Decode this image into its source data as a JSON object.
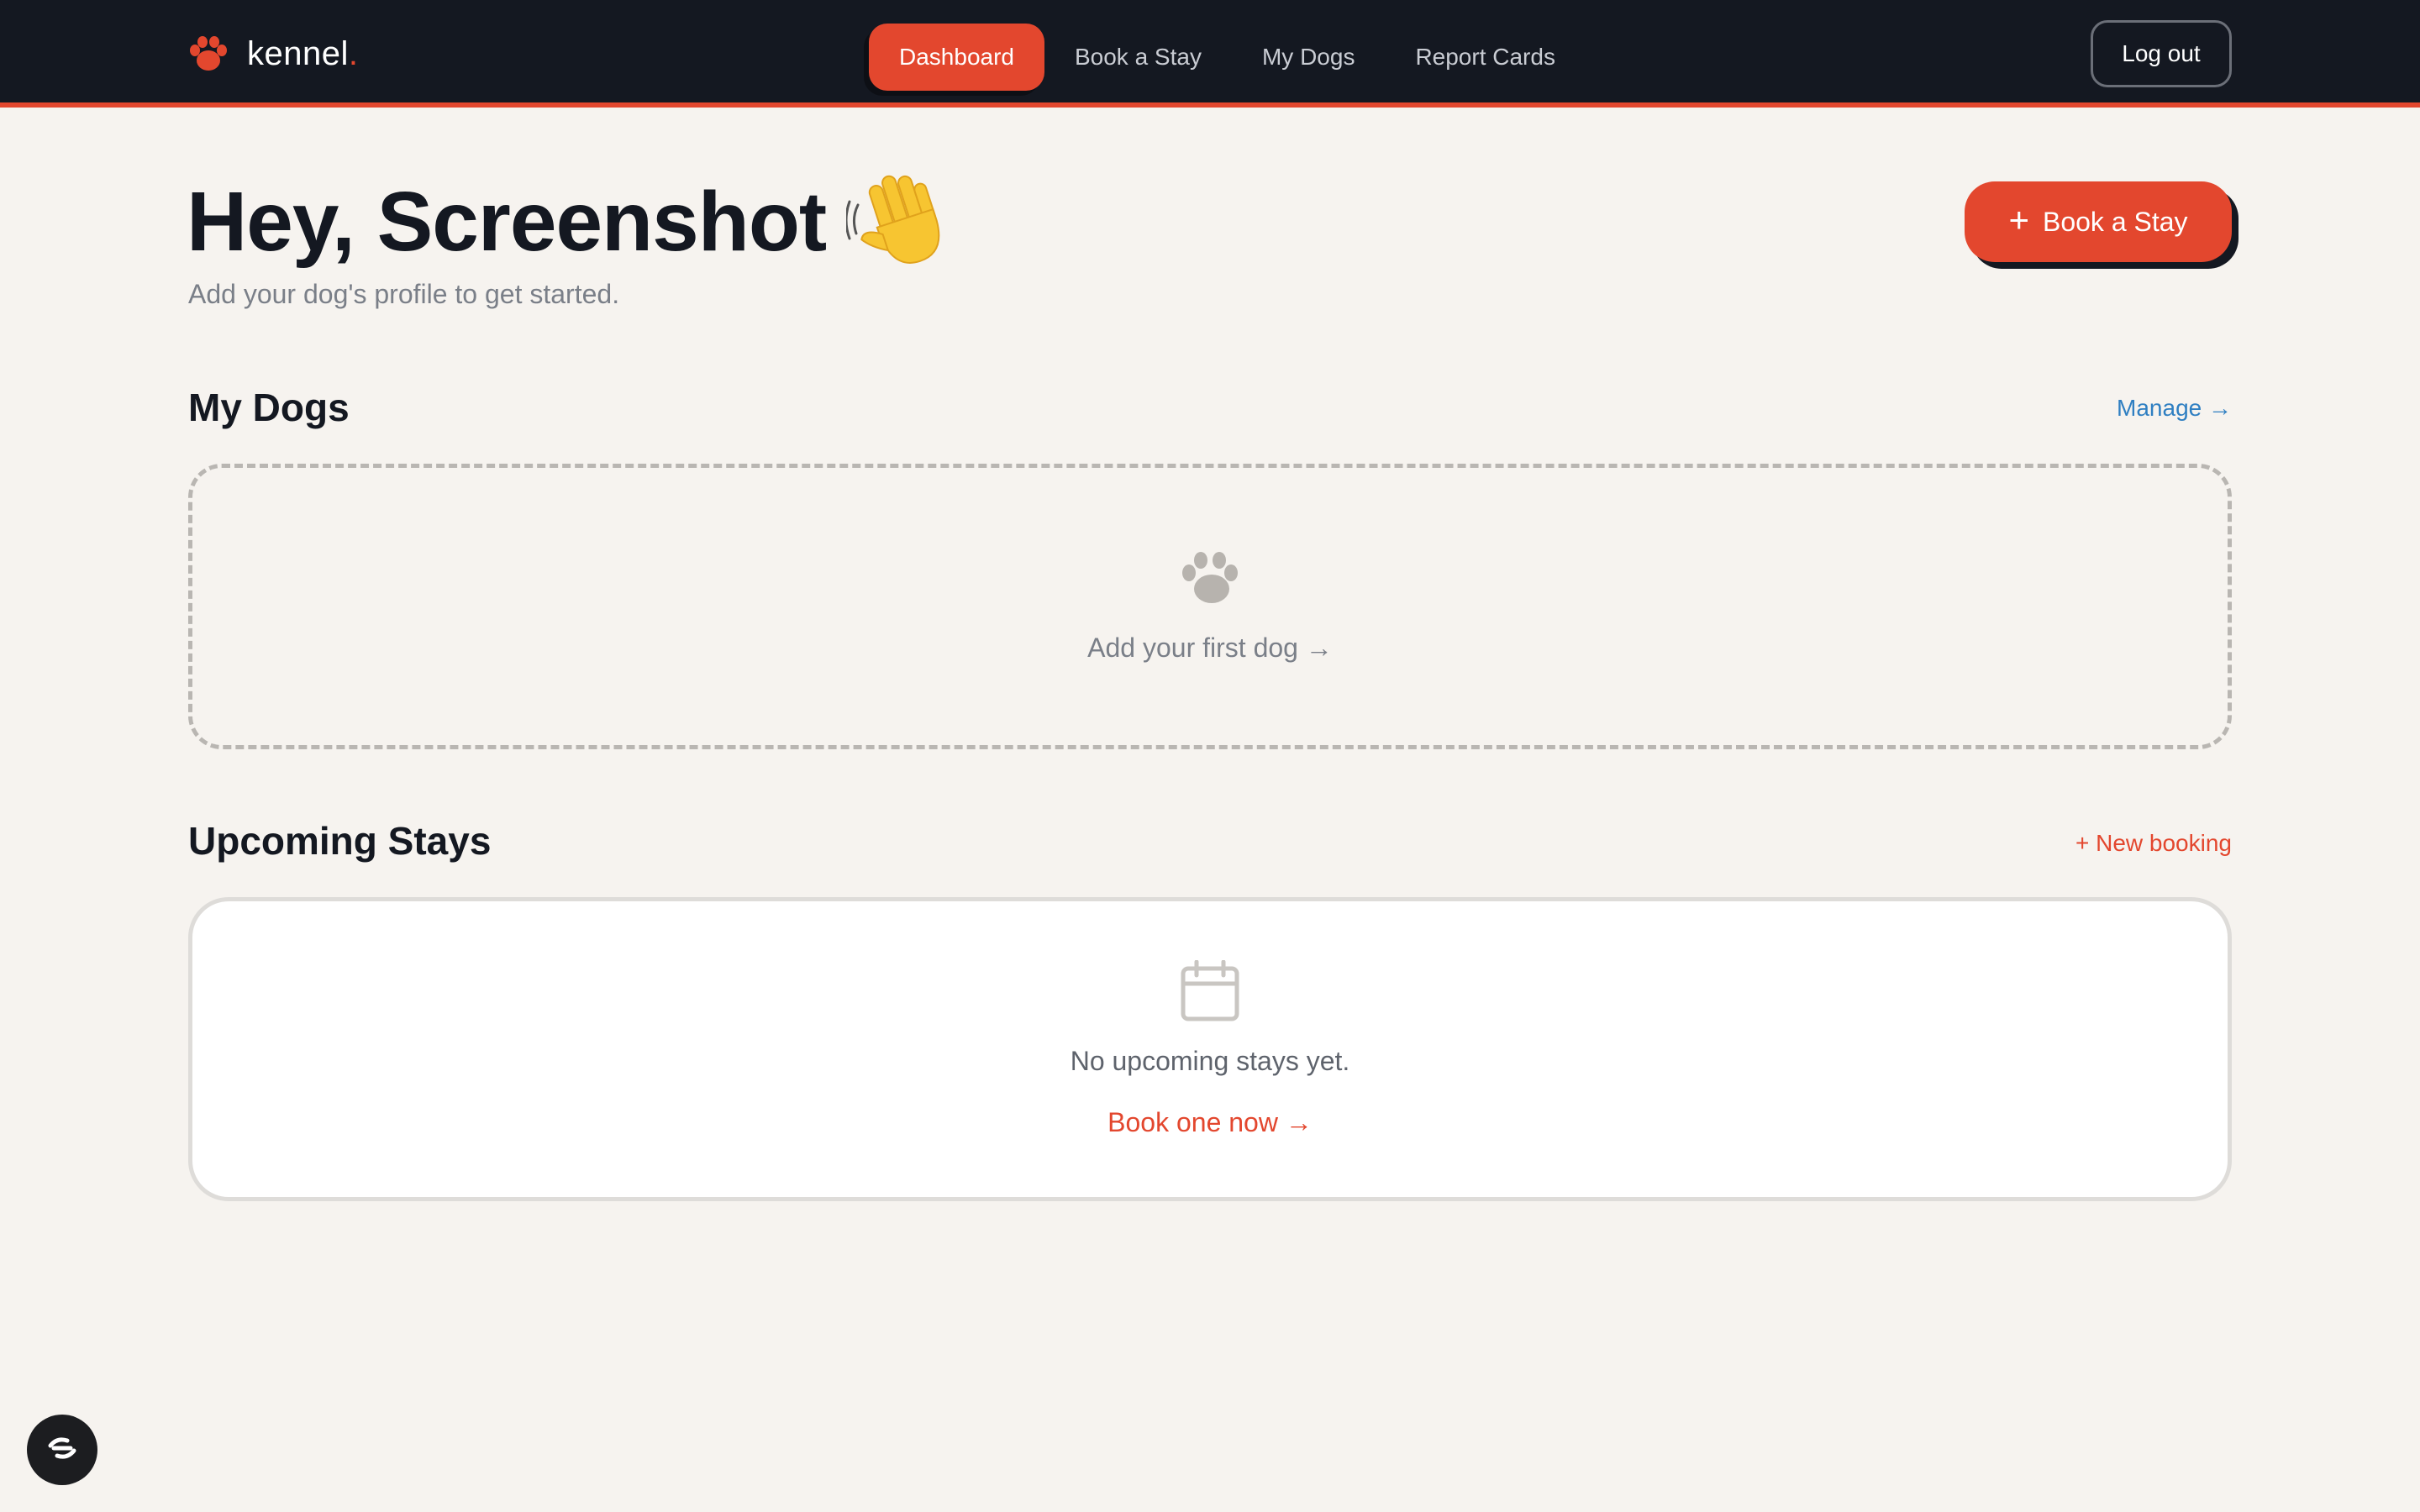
{
  "brand": {
    "name": "kennel",
    "dot": "."
  },
  "nav": {
    "items": [
      {
        "label": "Dashboard",
        "active": true
      },
      {
        "label": "Book a Stay",
        "active": false
      },
      {
        "label": "My Dogs",
        "active": false
      },
      {
        "label": "Report Cards",
        "active": false
      }
    ],
    "logout_label": "Log out"
  },
  "header": {
    "greeting": "Hey, Screenshot",
    "greeting_icon": "waving-hand-icon",
    "subtitle": "Add your dog's profile to get started.",
    "cta_plus": "+",
    "cta_label": "Book a Stay"
  },
  "my_dogs": {
    "title": "My Dogs",
    "link": "Manage →",
    "empty_icon": "paw-icon",
    "empty_action": "Add your first dog →"
  },
  "upcoming_stays": {
    "title": "Upcoming Stays",
    "link": "+ New booking",
    "empty_icon": "calendar-icon",
    "empty_text": "No upcoming stays yet.",
    "empty_action": "Book one now →"
  },
  "floating_button": {
    "icon": "helper-icon"
  },
  "colors": {
    "accent": "#e3472e",
    "nav_bg": "#141821",
    "page_bg": "#f6f3ef",
    "link_blue": "#2f7fc2"
  }
}
